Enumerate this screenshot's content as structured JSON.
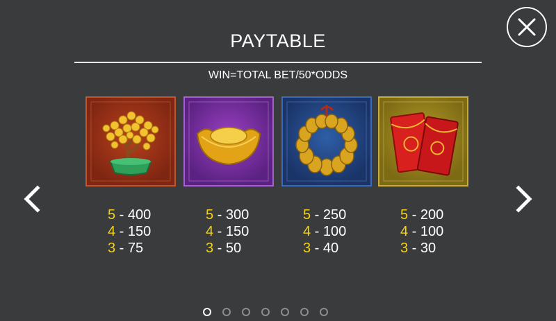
{
  "header": {
    "title": "PAYTABLE",
    "subtitle": "WIN=TOTAL BET/50*ODDS"
  },
  "close_icon": "close-icon",
  "navigation": {
    "prev_icon": "chevron-left-icon",
    "next_icon": "chevron-right-icon"
  },
  "symbols": [
    {
      "name": "money-tree-icon",
      "frame_color": "#a8361a",
      "payouts": [
        {
          "count": "5",
          "value": "400"
        },
        {
          "count": "4",
          "value": "150"
        },
        {
          "count": "3",
          "value": "75"
        }
      ]
    },
    {
      "name": "gold-ingot-icon",
      "frame_color": "#7a2fa5",
      "payouts": [
        {
          "count": "5",
          "value": "300"
        },
        {
          "count": "4",
          "value": "150"
        },
        {
          "count": "3",
          "value": "50"
        }
      ]
    },
    {
      "name": "coin-string-icon",
      "frame_color": "#23478a",
      "payouts": [
        {
          "count": "5",
          "value": "250"
        },
        {
          "count": "4",
          "value": "100"
        },
        {
          "count": "3",
          "value": "40"
        }
      ]
    },
    {
      "name": "red-envelope-icon",
      "frame_color": "#9b841e",
      "payouts": [
        {
          "count": "5",
          "value": "200"
        },
        {
          "count": "4",
          "value": "100"
        },
        {
          "count": "3",
          "value": "30"
        }
      ]
    }
  ],
  "pagination": {
    "total_pages": 7,
    "current_page": 1
  },
  "colors": {
    "background": "#3a3b3d",
    "count_highlight": "#f3d21a",
    "text": "#ffffff"
  }
}
